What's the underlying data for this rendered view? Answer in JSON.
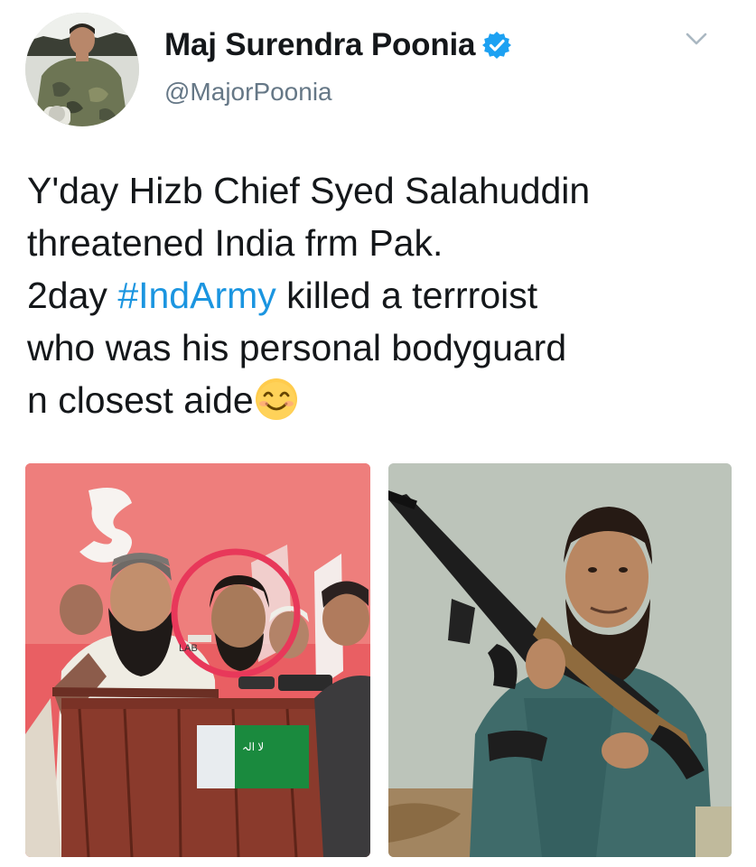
{
  "tweet": {
    "author": {
      "display_name": "Maj Surendra Poonia",
      "handle": "@MajorPoonia",
      "verified": true,
      "verified_color": "#1da1f2"
    },
    "text_lines": [
      {
        "text": "Y'day Hizb Chief Syed Salahuddin"
      },
      {
        "text": "threatened India frm Pak."
      },
      {
        "before": "2day ",
        "hashtag": "#IndArmy",
        "after": " killed a terrroist"
      },
      {
        "text": "who was his personal bodyguard"
      },
      {
        "text": "n closest aide",
        "emoji": "smiling-face-with-smiling-eyes-emoji"
      }
    ],
    "hashtag_color": "#1b95e0",
    "menu_icon": "chevron-down-icon",
    "media": {
      "left_photo": {
        "description_icon": "rally-photo",
        "highlight_color": "#e8385a"
      },
      "right_photo": {
        "description_icon": "armed-man-photo"
      }
    }
  }
}
